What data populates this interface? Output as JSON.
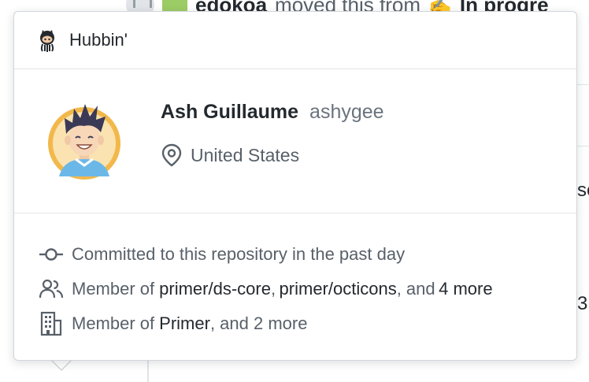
{
  "background": {
    "actor": "edokoa",
    "action_text": "moved this from",
    "column": "In progre",
    "side_fragment_1": "se",
    "side_fragment_2": "3"
  },
  "popover": {
    "org_name": "Hubbin'",
    "user": {
      "full_name": "Ash Guillaume",
      "login": "ashygee",
      "location": "United States"
    },
    "activity": {
      "commit_text": "Committed to this repository in the past day",
      "teams": {
        "prefix": "Member of",
        "team1": "primer/ds-core",
        "sep": ",",
        "team2": "primer/octicons",
        "and_text": ", and",
        "more": "4 more"
      },
      "orgs": {
        "prefix": "Member of",
        "org1": "Primer",
        "suffix": ", and 2 more"
      }
    }
  },
  "colors": {
    "text_primary": "#24292e",
    "text_secondary": "#586069",
    "login_gray": "#6a737d",
    "border": "#e1e4e8",
    "avatar_ring": "#f2b84b",
    "avatar_shirt": "#6bb8e8"
  },
  "icons": {
    "org": "octocat-icon",
    "location": "location-pin-icon",
    "commit": "git-commit-icon",
    "teams": "people-icon",
    "orgs": "organization-icon"
  }
}
